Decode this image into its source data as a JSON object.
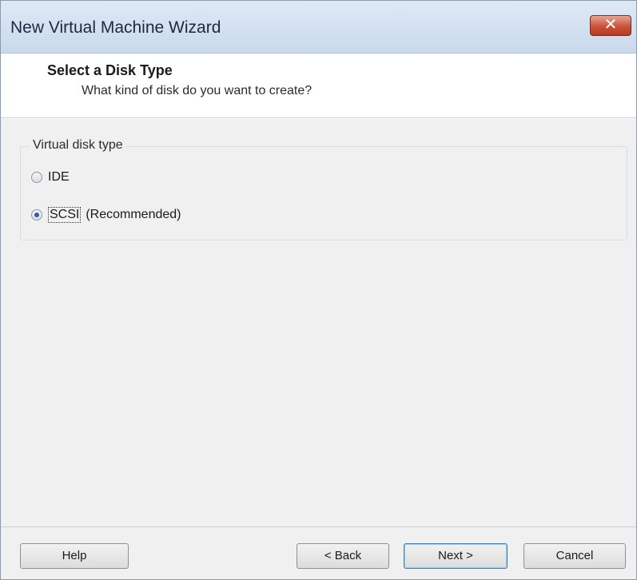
{
  "window": {
    "title": "New Virtual Machine Wizard",
    "close_label": "✕"
  },
  "header": {
    "title": "Select a Disk Type",
    "subtitle": "What kind of disk do you want to create?"
  },
  "disk_type": {
    "group_label": "Virtual disk type",
    "options": [
      {
        "label": "IDE",
        "extra": "",
        "selected": false
      },
      {
        "label": "SCSI",
        "extra": "(Recommended)",
        "selected": true
      }
    ]
  },
  "footer": {
    "help": "Help",
    "back": "< Back",
    "next": "Next >",
    "cancel": "Cancel"
  }
}
